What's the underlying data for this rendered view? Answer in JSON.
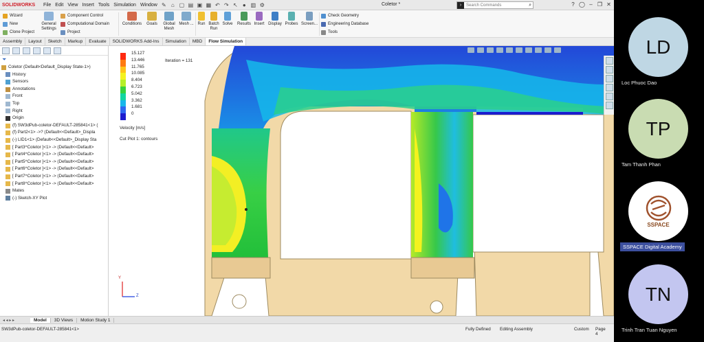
{
  "app": {
    "logo": "SOLIDWORKS",
    "doc_title": "Coletor *"
  },
  "menu": [
    "File",
    "Edit",
    "View",
    "Insert",
    "Tools",
    "Simulation",
    "Window"
  ],
  "search": {
    "placeholder": "Search Commands"
  },
  "ribbon": {
    "wizard": "Wizard",
    "new": "New",
    "clone": "Clone Project",
    "general_settings": "General Settings",
    "component_control": "Component Control",
    "computational_domain": "Computational Domain",
    "project": "Project",
    "conditions": "Conditions",
    "goals": "Goals",
    "global_mesh": "Global Mesh",
    "mesh": "Mesh ...",
    "run": "Run",
    "batch_run": "Batch Run",
    "solve": "Solve",
    "results": "Results",
    "insert": "Insert",
    "display": "Display",
    "probes": "Probes",
    "screen": "Screen...",
    "check_geometry": "Check Geometry",
    "engineering_database": "Engineering Database",
    "tools": "Tools"
  },
  "tabs": [
    "Assembly",
    "Layout",
    "Sketch",
    "Markup",
    "Evaluate",
    "SOLIDWORKS Add-Ins",
    "Simulation",
    "MBD",
    "Flow Simulation"
  ],
  "active_tab": "Flow Simulation",
  "tree": [
    {
      "label": "Coletor  (Default<Default_Display State-1>)",
      "icon": "assembly-icon",
      "indent": 0
    },
    {
      "label": "History",
      "icon": "history-icon",
      "indent": 1
    },
    {
      "label": "Sensors",
      "icon": "sensor-icon",
      "indent": 1
    },
    {
      "label": "Annotations",
      "icon": "annotation-icon",
      "indent": 1
    },
    {
      "label": "Front",
      "icon": "plane-icon",
      "indent": 1
    },
    {
      "label": "Top",
      "icon": "plane-icon",
      "indent": 1
    },
    {
      "label": "Right",
      "icon": "plane-icon",
      "indent": 1
    },
    {
      "label": "Origin",
      "icon": "origin-icon",
      "indent": 1
    },
    {
      "label": "(f) SW3dPub-coletor-DEFAULT-285841<1> (",
      "icon": "part-icon",
      "indent": 1
    },
    {
      "label": "(f) Part2<1> ->? (Default<<Default>_Displa",
      "icon": "part-icon",
      "indent": 1
    },
    {
      "label": "(-) LID1<1> (Default<<Default>_Display Sta",
      "icon": "part-icon",
      "indent": 1
    },
    {
      "label": "[ Part3^Coletor ]<1> -> (Default<<Default>",
      "icon": "part-icon",
      "indent": 1
    },
    {
      "label": "[ Part4^Coletor ]<1> -> (Default<<Default>",
      "icon": "part-icon",
      "indent": 1
    },
    {
      "label": "[ Part5^Coletor ]<1> -> (Default<<Default>",
      "icon": "part-icon",
      "indent": 1
    },
    {
      "label": "[ Part6^Coletor ]<1> -> (Default<<Default>",
      "icon": "part-icon",
      "indent": 1
    },
    {
      "label": "[ Part7^Coletor ]<1> -> (Default<<Default>",
      "icon": "part-icon",
      "indent": 1
    },
    {
      "label": "[ Part8^Coletor ]<1> -> (Default<<Default>",
      "icon": "part-icon",
      "indent": 1
    },
    {
      "label": "Mates",
      "icon": "mates-icon",
      "indent": 1
    },
    {
      "label": "(-) Sketch-XY Plot",
      "icon": "sketch-icon",
      "indent": 1
    }
  ],
  "legend": {
    "values": [
      "15.127",
      "13.446",
      "11.765",
      "10.085",
      "8.404",
      "6.723",
      "5.042",
      "3.362",
      "1.681",
      "0"
    ],
    "colors": [
      "#ff2a10",
      "#ff7a10",
      "#ffc418",
      "#f4f21e",
      "#b6ef28",
      "#38d23c",
      "#12d6a0",
      "#18b7ea",
      "#2e68f0",
      "#1c1cce"
    ],
    "title": "Velocity [m/s]",
    "cut_plot": "Cut Plot 1: contours"
  },
  "iteration": "Iteration = 131",
  "axis": {
    "y": "Y",
    "z": "Z"
  },
  "bottom_tabs": [
    "Model",
    "3D Views",
    "Motion Study 1"
  ],
  "active_bottom_tab": "Model",
  "status": {
    "file": "SW3dPub-coletor-DEFAULT-285841<1>",
    "state": "Fully Defined",
    "editing": "Editing Assembly",
    "units": "Custom",
    "page": "Page 4"
  },
  "participants": [
    {
      "initials": "LD",
      "name": "Loc Phuoc Dao",
      "color": "#bfd7e4"
    },
    {
      "initials": "TP",
      "name": "Tam Thanh Phan",
      "color": "#c9dcb2"
    },
    {
      "initials": "",
      "name": "SSPACE Digital Academy",
      "logo_text": "SSPACE",
      "color": "#ffffff"
    },
    {
      "initials": "TN",
      "name": "Trinh Tran Tuan Nguyen",
      "color": "#c3c6f0"
    }
  ]
}
